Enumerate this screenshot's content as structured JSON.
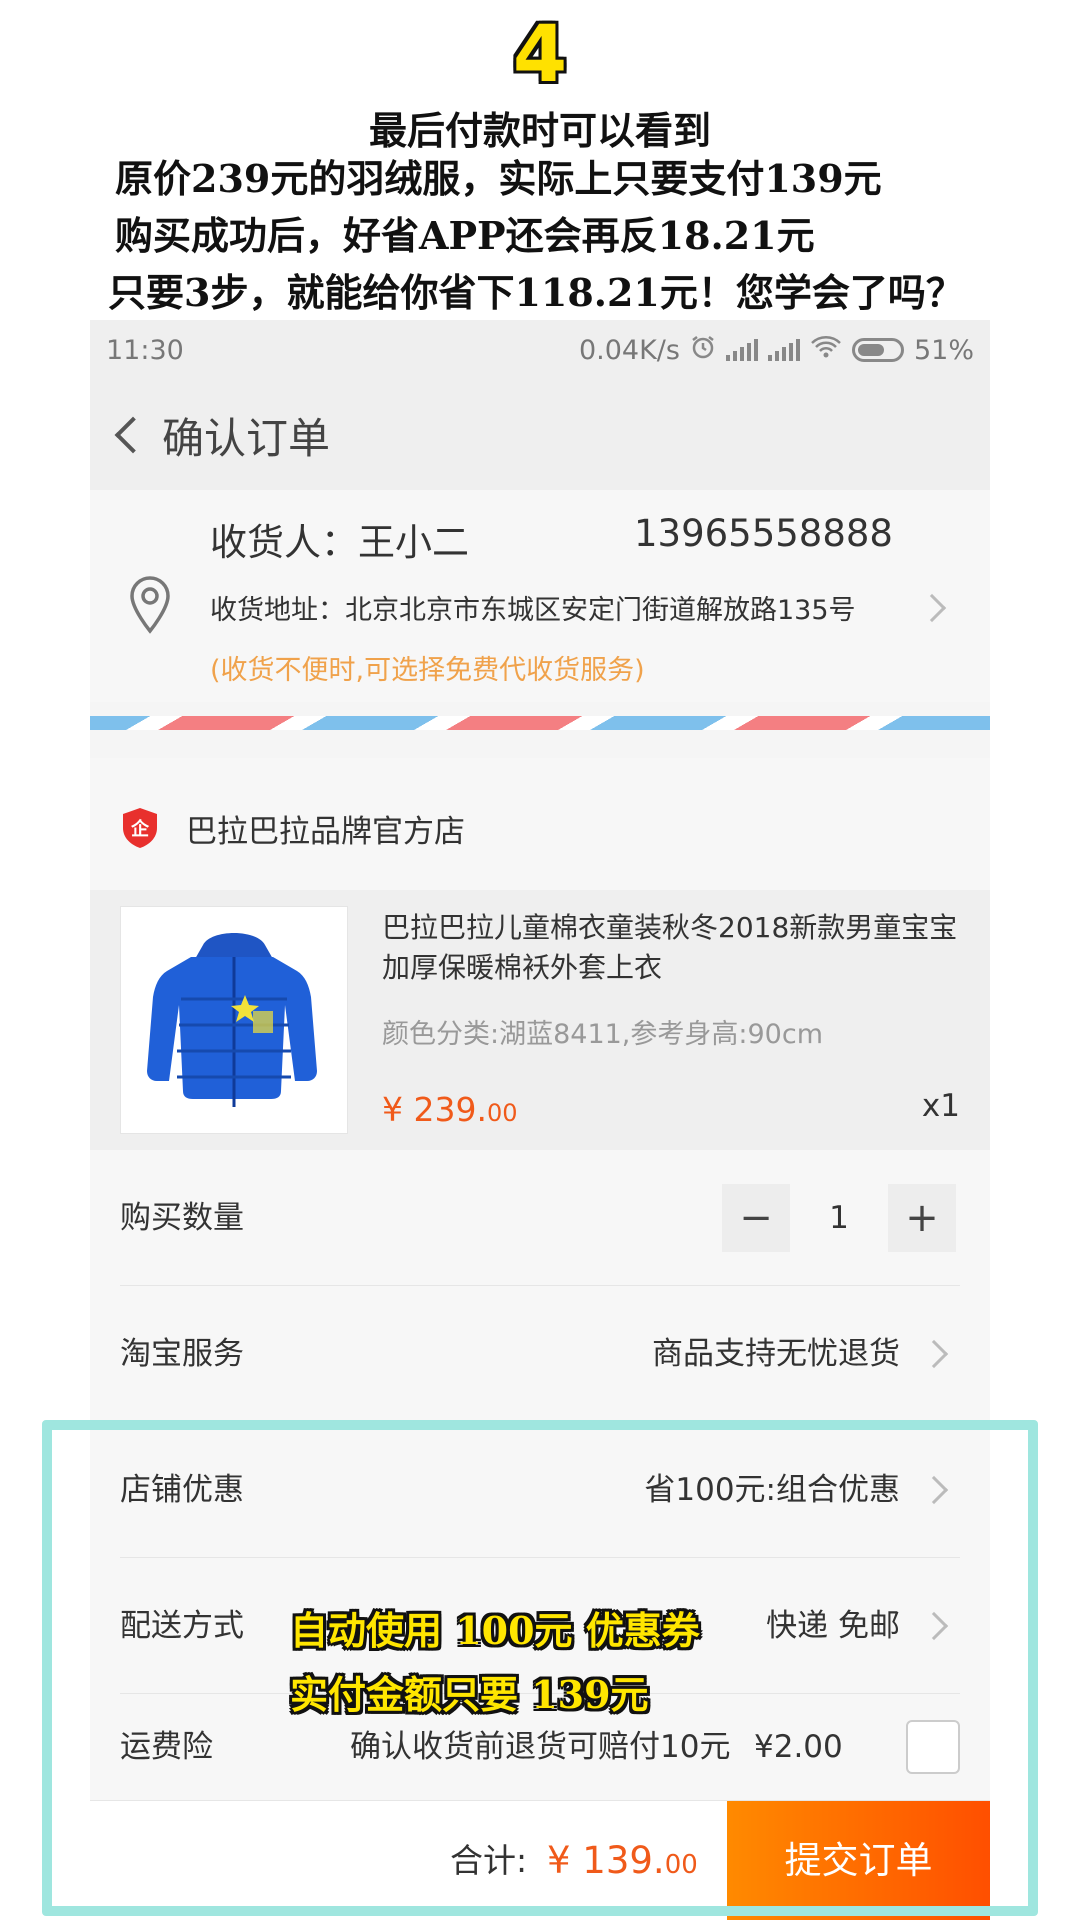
{
  "caption": {
    "step": "4",
    "lines": [
      "最后付款时可以看到",
      "原价239元的羽绒服，实际上只要支付139元",
      "购买成功后，好省APP还会再反18.21元",
      "只要3步，就能给你省下118.21元！您学会了吗？"
    ]
  },
  "statusbar": {
    "time": "11:30",
    "speed": "0.04K/s",
    "battery": "51%"
  },
  "navbar": {
    "title": "确认订单"
  },
  "address": {
    "receiver": "收货人：王小二",
    "phone": "13965558888",
    "address": "收货地址：北京北京市东城区安定门街道解放路135号",
    "hint": "(收货不便时,可选择免费代收货服务)"
  },
  "store": {
    "name": "巴拉巴拉品牌官方店",
    "badge_text": "企"
  },
  "product": {
    "title": "巴拉巴拉儿童棉衣童装秋冬2018新款男童宝宝加厚保暖棉袄外套上衣",
    "spec": "颜色分类:湖蓝8411,参考身高:90cm",
    "price_main": "¥ 239.",
    "price_cents": "00",
    "quantity": "x1"
  },
  "quantity_row": {
    "label": "购买数量",
    "minus": "−",
    "value": "1",
    "plus": "+"
  },
  "service_row": {
    "label": "淘宝服务",
    "value": "商品支持无忧退货"
  },
  "discount_row": {
    "label": "店铺优惠",
    "value": "省100元:组合优惠"
  },
  "shipping_row": {
    "label": "配送方式",
    "value": "快递 免邮"
  },
  "insurance_row": {
    "label": "运费险",
    "value": "确认收货前退货可赔付10元",
    "price": "¥2.00"
  },
  "footer": {
    "total_label": "合计:",
    "total_main": "¥ 139.",
    "total_cents": "00",
    "submit": "提交订单"
  },
  "overlay": {
    "line1": "自动使用 100元 优惠券",
    "line2": "实付金额只要 139元"
  },
  "colors": {
    "accent": "#f05a1a",
    "hint": "#f0a24b",
    "highlight": "#9fe6df",
    "overlay": "#ffe600"
  }
}
